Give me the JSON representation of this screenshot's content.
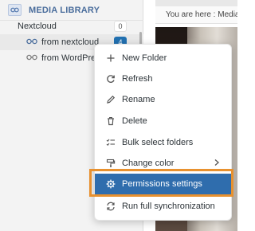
{
  "sidebar": {
    "title": "MEDIA LIBRARY",
    "icon": "media-library-icon",
    "items": [
      {
        "label": "Nextcloud",
        "count": "0"
      },
      {
        "label": "from nextcloud",
        "count": "4",
        "selected": true,
        "icon": "link-icon"
      },
      {
        "label": "from WordPres",
        "icon": "link-icon"
      }
    ]
  },
  "content": {
    "breadcrumb": "You are here :  Media"
  },
  "context_menu": {
    "items": [
      {
        "label": "New Folder",
        "icon": "folder-plus-icon"
      },
      {
        "label": "Refresh",
        "icon": "refresh-icon"
      },
      {
        "label": "Rename",
        "icon": "pencil-icon"
      },
      {
        "label": "Delete",
        "icon": "trash-icon"
      },
      {
        "label": "Bulk select folders",
        "icon": "checklist-icon"
      },
      {
        "label": "Change color",
        "icon": "paint-roller-icon",
        "submenu": true
      },
      {
        "label": "Permissions settings",
        "icon": "gear-icon",
        "highlighted": true
      },
      {
        "label": "Run full synchronization",
        "icon": "sync-icon"
      }
    ]
  },
  "colors": {
    "accent": "#2f6dad",
    "highlight_outline": "#e8912f",
    "count_active": "#2271b1"
  }
}
